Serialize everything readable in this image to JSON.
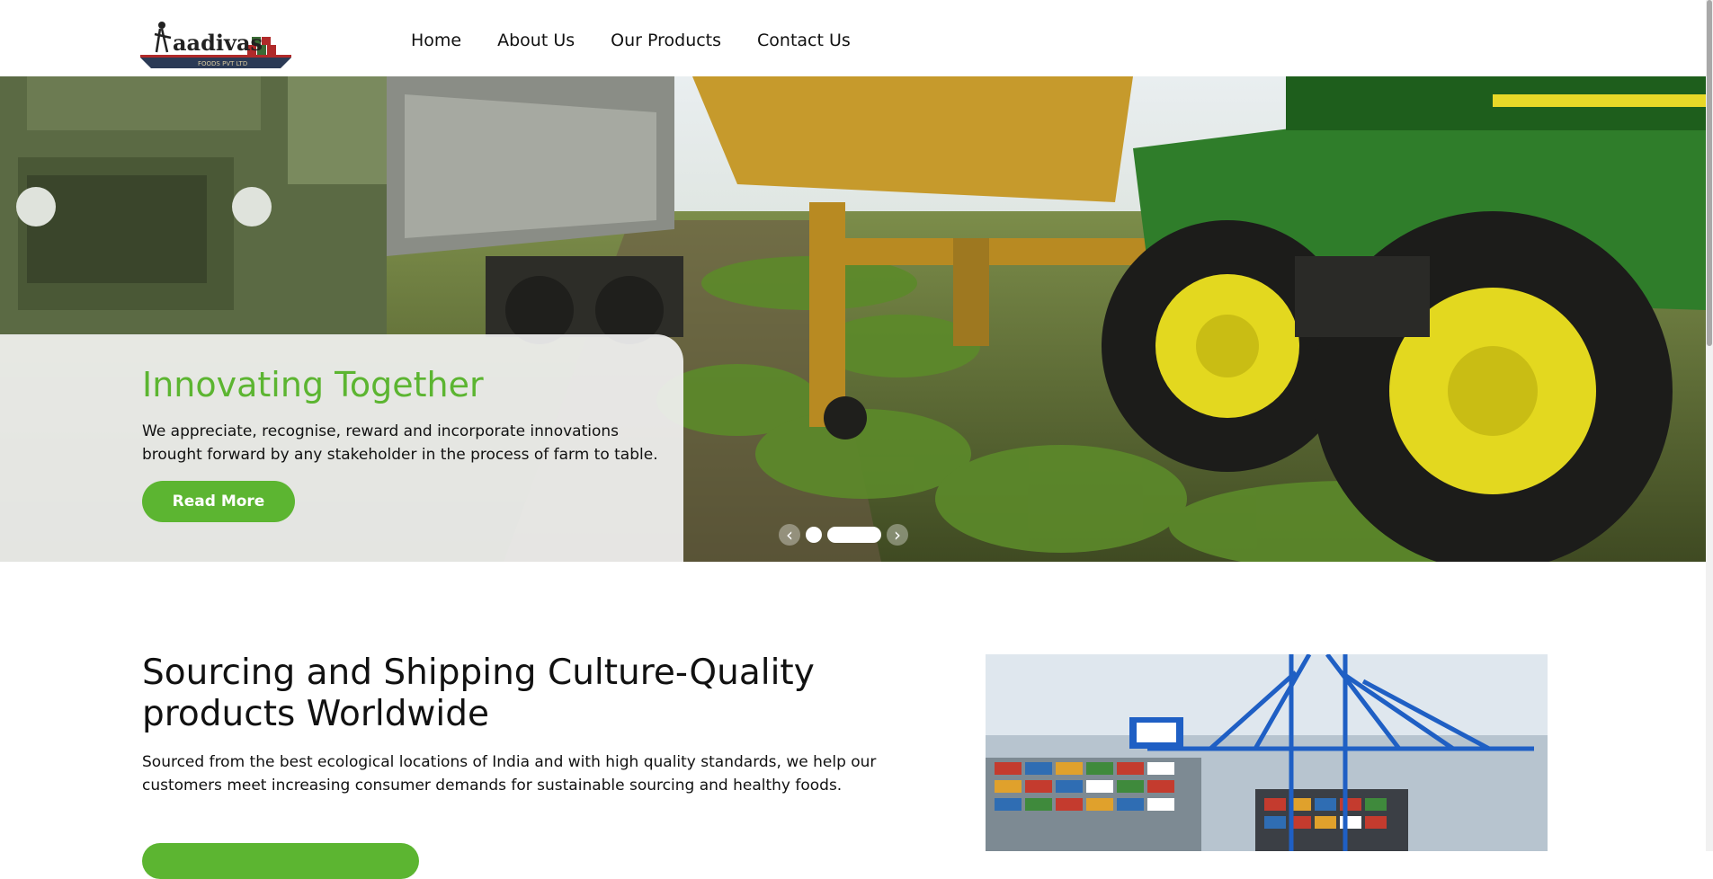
{
  "brand": {
    "logo_text": "aadivas",
    "logo_subtext": "FOODS PVT LTD"
  },
  "nav": {
    "items": [
      "Home",
      "About Us",
      "Our Products",
      "Contact Us"
    ]
  },
  "hero": {
    "title": "Innovating Together",
    "text": "We appreciate, recognise, reward and incorporate innovations brought forward by any stakeholder in the process of farm to table.",
    "button_label": "Read More",
    "slide_count": 2,
    "active_slide": 2
  },
  "section": {
    "title": "Sourcing and Shipping Culture-Quality products Worldwide",
    "text": "Sourced from the best ecological locations of India and with high quality standards, we help our customers meet increasing consumer demands for sustainable sourcing and healthy foods."
  },
  "colors": {
    "accent": "#5cb531",
    "text": "#111111",
    "background": "#ffffff"
  },
  "icons": {
    "prev": "chevron-left-icon",
    "next": "chevron-right-icon"
  }
}
